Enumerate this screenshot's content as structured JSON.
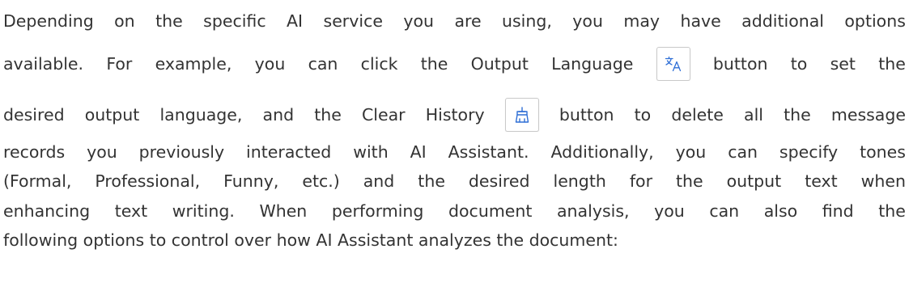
{
  "paragraph": {
    "line1": [
      "Depending",
      "on",
      "the",
      "specific",
      "AI",
      "service",
      "you",
      "are",
      "using,",
      "you",
      "may",
      "have",
      "additional",
      "options"
    ],
    "line2": {
      "before": [
        "available.",
        "For",
        "example,",
        "you",
        "can",
        "click",
        "the",
        "Output",
        "Language"
      ],
      "after": [
        "button",
        "to",
        "set",
        "the"
      ]
    },
    "line3": {
      "before": [
        "desired",
        "output",
        "language,",
        "and",
        "the",
        "Clear",
        "History"
      ],
      "after": [
        "button",
        "to",
        "delete",
        "all",
        "the",
        "message"
      ]
    },
    "line4": [
      "records",
      "you",
      "previously",
      "interacted",
      "with",
      "AI",
      "Assistant.",
      "Additionally,",
      "you",
      "can",
      "specify",
      "tones"
    ],
    "line5": [
      "(Formal,",
      "Professional,",
      "Funny,",
      "etc.)",
      "and",
      "the",
      "desired",
      "length",
      "for",
      "the",
      "output",
      "text",
      "when"
    ],
    "line6": [
      "enhancing",
      "text",
      "writing.",
      "When",
      "performing",
      "document",
      "analysis,",
      "you",
      "can",
      "also",
      "find",
      "the"
    ],
    "line7": "following options to control over how AI Assistant analyzes the document:"
  },
  "icons": {
    "output_language": "translate-icon",
    "clear_history": "clear-history-broom-icon"
  },
  "colors": {
    "text": "#333333",
    "icon_blue": "#2f6fd6",
    "button_border": "#c9c9c9"
  }
}
